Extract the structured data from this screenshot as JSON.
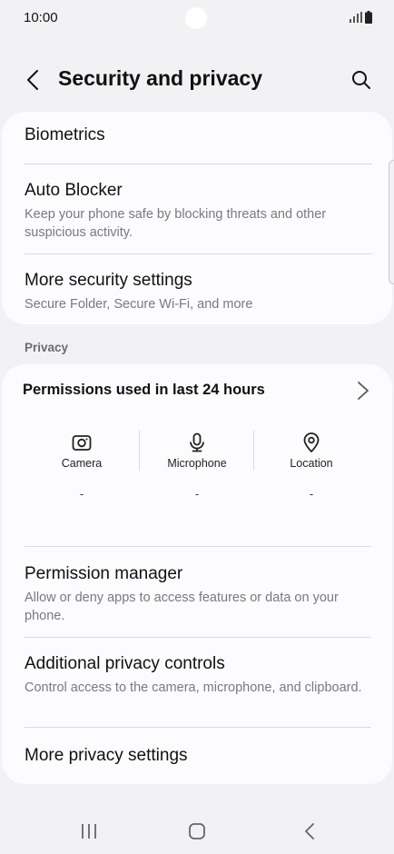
{
  "status": {
    "time": "10:00"
  },
  "header": {
    "title": "Security and privacy"
  },
  "security_card": {
    "items": [
      {
        "title": "Biometrics"
      },
      {
        "title": "Auto Blocker",
        "subtitle": "Keep your phone safe by blocking threats and other suspicious activity."
      },
      {
        "title": "More security settings",
        "subtitle": "Secure Folder, Secure Wi-Fi, and more"
      }
    ]
  },
  "privacy": {
    "section_label": "Privacy",
    "permissions_title": "Permissions used in last 24 hours",
    "permissions": [
      {
        "label": "Camera",
        "icon": "camera-icon",
        "value": "-"
      },
      {
        "label": "Microphone",
        "icon": "microphone-icon",
        "value": "-"
      },
      {
        "label": "Location",
        "icon": "location-pin-icon",
        "value": "-"
      }
    ],
    "items": [
      {
        "title": "Permission manager",
        "subtitle": "Allow or deny apps to access features or data on your phone."
      },
      {
        "title": "Additional privacy controls",
        "subtitle": "Control access to the camera, microphone, and clipboard."
      },
      {
        "title": "More privacy settings"
      }
    ]
  },
  "colors": {
    "background": "#f2f2f5",
    "card": "#fcfcfe",
    "subtitle": "#7a7a7e",
    "divider": "#dcdcdf"
  }
}
